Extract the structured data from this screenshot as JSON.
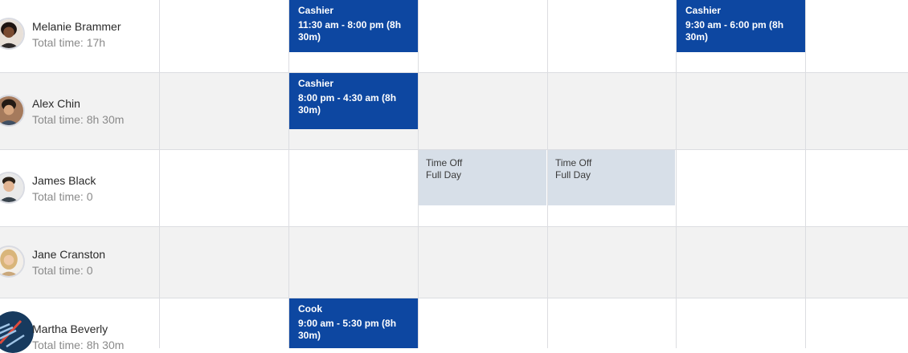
{
  "employees": [
    {
      "name": "Melanie Brammer",
      "total": "Total time: 17h",
      "avatar_icon": "person-avatar-dark-hair",
      "shifts": [
        {
          "day": 1,
          "role": "Cashier",
          "time": "11:30 am - 8:00 pm (8h 30m)"
        },
        {
          "day": 4,
          "role": "Cashier",
          "time": "9:30 am - 6:00 pm (8h 30m)"
        }
      ],
      "time_off": []
    },
    {
      "name": "Alex Chin",
      "total": "Total time: 8h 30m",
      "avatar_icon": "person-avatar-dark-hair",
      "shifts": [
        {
          "day": 1,
          "role": "Cashier",
          "time": "8:00 pm - 4:30 am (8h 30m)"
        }
      ],
      "time_off": []
    },
    {
      "name": "James Black",
      "total": "Total time: 0",
      "avatar_icon": "person-avatar-short-hair",
      "shifts": [],
      "time_off": [
        {
          "day": 2,
          "label": "Time Off",
          "detail": "Full Day"
        },
        {
          "day": 3,
          "label": "Time Off",
          "detail": "Full Day"
        }
      ]
    },
    {
      "name": "Jane Cranston",
      "total": "Total time: 0",
      "avatar_icon": "person-avatar-blonde-hair",
      "shifts": [],
      "time_off": []
    },
    {
      "name": "Martha Beverly",
      "total": "Total time: 8h 30m",
      "avatar_icon": "compass-logo-avatar",
      "shifts": [
        {
          "day": 1,
          "role": "Cook",
          "time": "9:00 am - 5:30 pm (8h 30m)"
        }
      ],
      "time_off": []
    }
  ],
  "colors": {
    "shift_bg": "#0d47a1",
    "time_off_bg": "#d7dfe8",
    "alt_row_bg": "#f2f2f2",
    "grid_line": "#dcdde1"
  }
}
